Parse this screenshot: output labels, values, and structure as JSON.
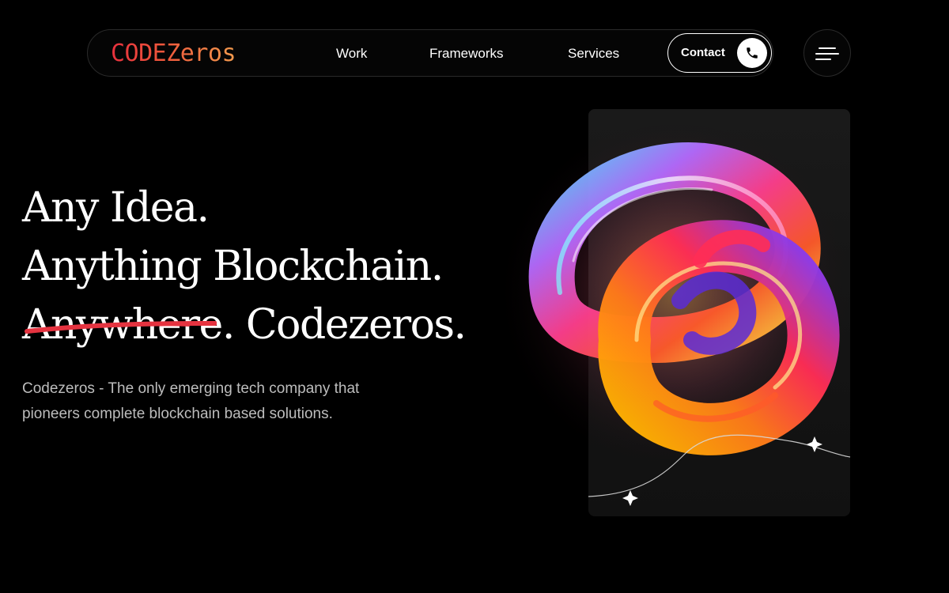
{
  "nav": {
    "logo_text": "CODEZeros",
    "links": [
      "Work",
      "Frameworks",
      "Services"
    ],
    "contact_label": "Contact"
  },
  "hero": {
    "line1": "Any Idea.",
    "line2": "Anything Blockchain.",
    "line3_struck": "Anywhere",
    "line3_rest": ". Codezeros.",
    "description": "Codezeros - The only emerging tech company that pioneers complete blockchain based solutions."
  },
  "colors": {
    "background": "#000000",
    "logo_gradient_start": "#e8303d",
    "logo_gradient_end": "#f29a4d",
    "strike": "#e53340",
    "description_text": "#bdbdbd"
  },
  "icons": {
    "contact": "phone-icon",
    "menu": "hamburger-menu-icon",
    "sparkle": "sparkle-icon"
  }
}
